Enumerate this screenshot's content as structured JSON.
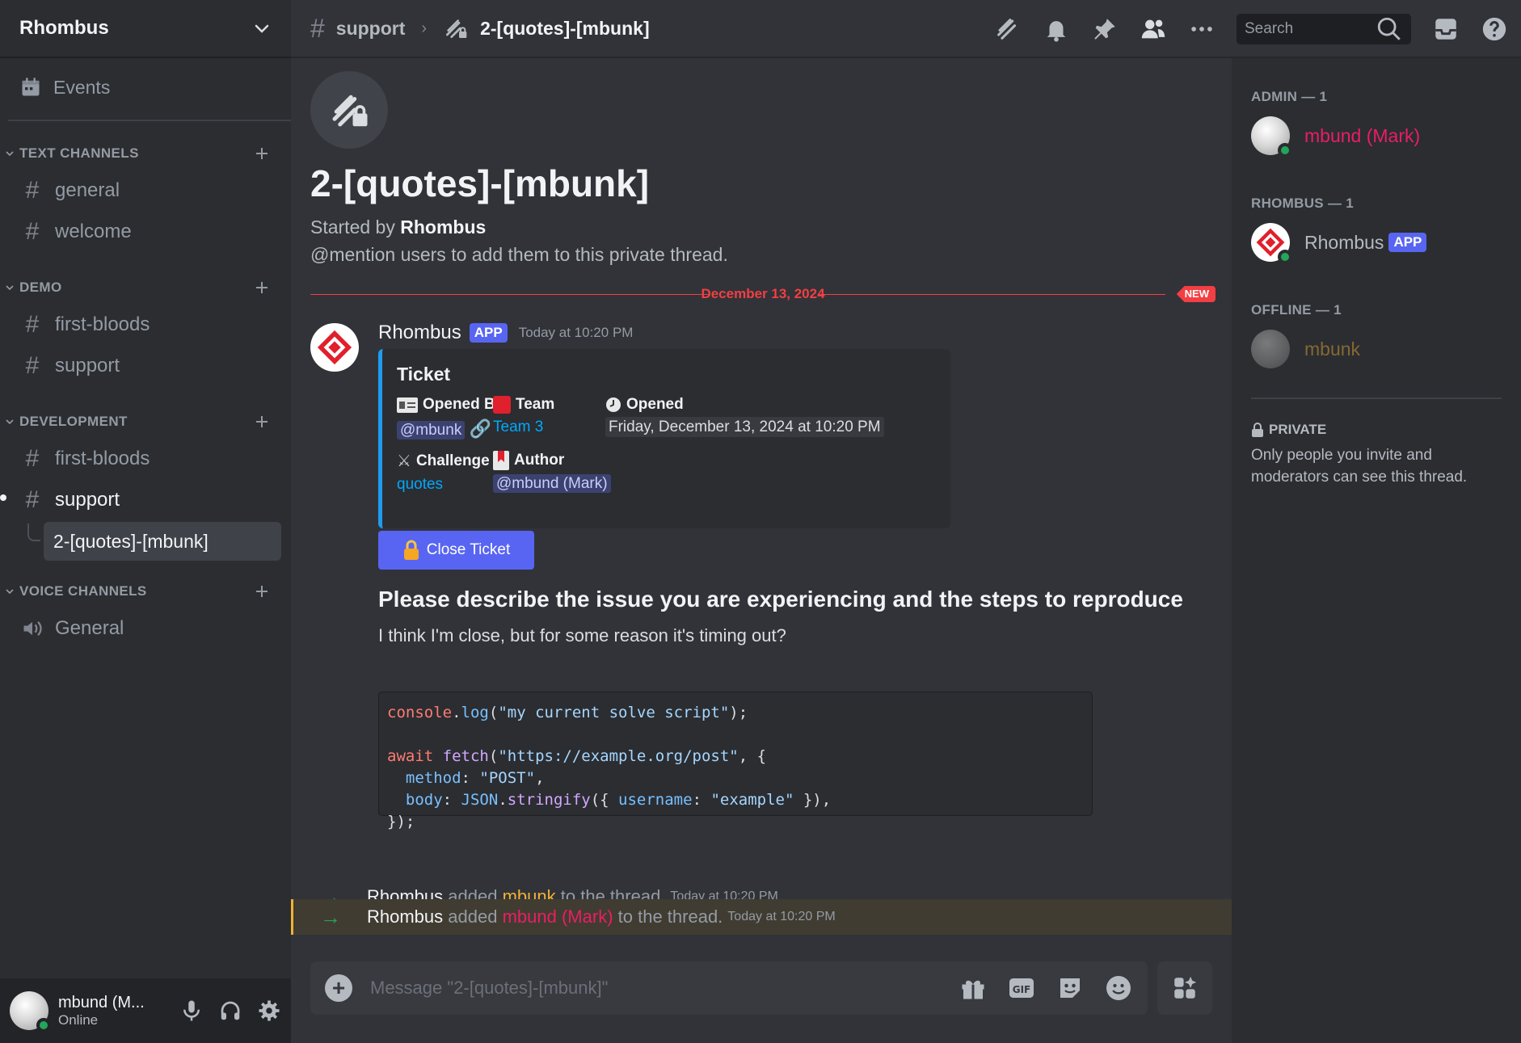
{
  "server": {
    "name": "Rhombus"
  },
  "sidebar": {
    "events_label": "Events",
    "categories": [
      {
        "label": "TEXT CHANNELS",
        "channels": [
          "general",
          "welcome"
        ]
      },
      {
        "label": "DEMO",
        "channels": [
          "first-bloods",
          "support"
        ]
      },
      {
        "label": "DEVELOPMENT",
        "channels": [
          "first-bloods",
          "support"
        ],
        "thread": "2-[quotes]-[mbunk]"
      },
      {
        "label": "VOICE CHANNELS",
        "channels": [
          "General"
        ]
      }
    ]
  },
  "user": {
    "name": "mbund (M...",
    "status": "Online"
  },
  "topbar": {
    "parent_channel": "support",
    "thread": "2-[quotes]-[mbunk]",
    "search_placeholder": "Search"
  },
  "thread": {
    "title": "2-[quotes]-[mbunk]",
    "started_prefix": "Started by",
    "started_by": "Rhombus",
    "hint": "@mention users to add them to this private thread.",
    "date_divider": "December 13, 2024",
    "new_badge": "NEW"
  },
  "message": {
    "author": "Rhombus",
    "app_tag": "APP",
    "timestamp": "Today at 10:20 PM",
    "embed": {
      "title": "Ticket",
      "fields": {
        "opened_by": {
          "name": "Opened By",
          "value": "@mbunk"
        },
        "team": {
          "name": "Team",
          "value": "Team 3"
        },
        "opened": {
          "name": "Opened",
          "value": "Friday, December 13, 2024 at 10:20 PM"
        },
        "challenge": {
          "name": "Challenge",
          "value": "quotes"
        },
        "author": {
          "name": "Author",
          "value": "@mbund (Mark)"
        }
      }
    },
    "close_button": "Close Ticket",
    "desc_title": "Please describe the issue you are experiencing and the steps to reproduce",
    "desc_body": "I think I'm close, but for some reason it's timing out?"
  },
  "system_messages": [
    {
      "actor": "Rhombus",
      "verb": "added",
      "target": "mbunk",
      "tail": "to the thread.",
      "time": "Today at 10:20 PM"
    },
    {
      "actor": "Rhombus",
      "verb": "added",
      "target": "mbund (Mark)",
      "tail": "to the thread.",
      "time": "Today at 10:20 PM"
    }
  ],
  "composer": {
    "placeholder": "Message \"2-[quotes]-[mbunk]\""
  },
  "members": {
    "admin_label": "ADMIN — 1",
    "admin_member": "mbund (Mark)",
    "rhombus_label": "RHOMBUS — 1",
    "rhombus_member": "Rhombus",
    "rhombus_tag": "APP",
    "offline_label": "OFFLINE — 1",
    "offline_member": "mbunk",
    "private_title": "PRIVATE",
    "private_body": "Only people you invite and moderators can see this thread."
  },
  "colors": {
    "accent": "#5865f2",
    "online": "#23a55a",
    "new": "#f23f43",
    "admin": "#e91e63",
    "mbunk": "#f0b232",
    "embed_bar": "#1e9cf0"
  }
}
